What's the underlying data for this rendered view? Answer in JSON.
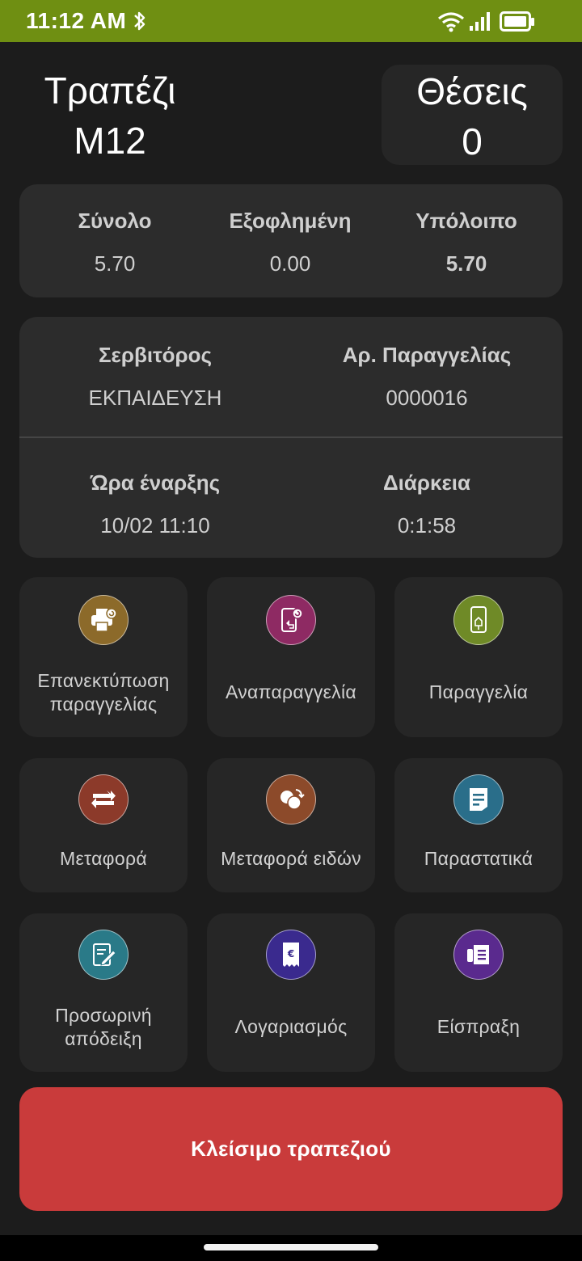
{
  "status_bar": {
    "time": "11:12 AM"
  },
  "header": {
    "table_label": "Τραπέζι",
    "table_value": "M12",
    "seats_label": "Θέσεις",
    "seats_value": "0"
  },
  "summary": {
    "total_label": "Σύνολο",
    "total_value": "5.70",
    "paid_label": "Εξοφλημένη",
    "paid_value": "0.00",
    "balance_label": "Υπόλοιπο",
    "balance_value": "5.70"
  },
  "info": {
    "waiter_label": "Σερβιτόρος",
    "waiter_value": "ΕΚΠΑΙΔΕΥΣΗ",
    "order_no_label": "Αρ. Παραγγελίας",
    "order_no_value": "0000016",
    "start_label": "Ώρα έναρξης",
    "start_value": "10/02 11:10",
    "duration_label": "Διάρκεια",
    "duration_value": "0:1:58"
  },
  "actions": [
    {
      "line1": "Επανεκτύπωση",
      "line2": "παραγγελίας",
      "icon": "reprint-icon",
      "color": "#8c6a2a"
    },
    {
      "line1": "Αναπαραγγελία",
      "line2": "",
      "icon": "reorder-icon",
      "color": "#8e2a63"
    },
    {
      "line1": "Παραγγελία",
      "line2": "",
      "icon": "order-icon",
      "color": "#6f8a27"
    },
    {
      "line1": "Μεταφορά",
      "line2": "",
      "icon": "transfer-icon",
      "color": "#8c3a2a"
    },
    {
      "line1": "Μεταφορά ειδών",
      "line2": "",
      "icon": "transfer-items-icon",
      "color": "#8c4a2a"
    },
    {
      "line1": "Παραστατικά",
      "line2": "",
      "icon": "documents-icon",
      "color": "#2a6e8a"
    },
    {
      "line1": "Προσωρινή",
      "line2": "απόδειξη",
      "icon": "temp-receipt-icon",
      "color": "#2a7a88"
    },
    {
      "line1": "Λογαριασμός",
      "line2": "",
      "icon": "bill-icon",
      "color": "#3a2a8e"
    },
    {
      "line1": "Είσπραξη",
      "line2": "",
      "icon": "payment-icon",
      "color": "#5a2a8e"
    }
  ],
  "close_button": {
    "label": "Κλείσιμο τραπεζιού",
    "color": "#c93b3b"
  },
  "colors": {
    "status_bar": "#6f8f12",
    "background": "#1c1c1c",
    "card": "#2c2c2c"
  }
}
